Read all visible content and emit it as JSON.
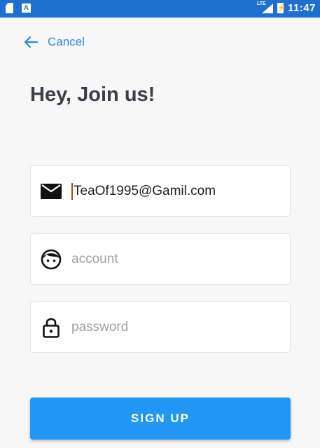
{
  "status_bar": {
    "notification_icons": [
      "sim-card-icon",
      "a-letter-icon"
    ],
    "a_icon_text": "A",
    "network_label": "LTE",
    "time": "11:47",
    "background_color": "#1f6fd1"
  },
  "nav": {
    "back_icon": "arrow-left-icon",
    "cancel_label": "Cancel"
  },
  "title": "Hey, Join us!",
  "form": {
    "email": {
      "icon": "mail-icon",
      "value": "TeaOf1995@Gamil.com",
      "placeholder": ""
    },
    "account": {
      "icon": "face-icon",
      "value": "",
      "placeholder": "account"
    },
    "password": {
      "icon": "lock-icon",
      "value": "",
      "placeholder": "password"
    }
  },
  "signup_button": {
    "label": "SIGN UP",
    "color": "#2196f3"
  },
  "colors": {
    "accent": "#2d8be0",
    "title": "#3a3e47",
    "caret": "#c0392b"
  }
}
